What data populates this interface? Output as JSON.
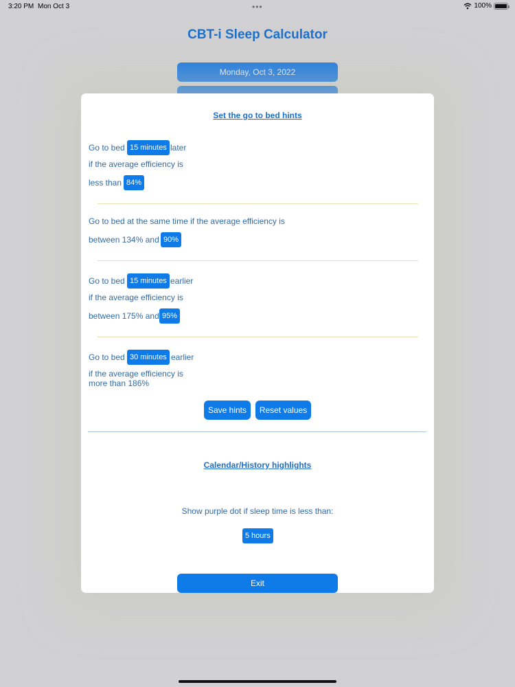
{
  "status_bar": {
    "time": "3:20 PM",
    "date": "Mon Oct 3",
    "battery": "100%",
    "battery_level": 1.0
  },
  "app": {
    "title": "CBT-i Sleep Calculator",
    "date_button": "Monday, Oct 3, 2022"
  },
  "modal": {
    "hints_title": "Set the go to bed hints",
    "rule1": {
      "prefix": "Go to bed",
      "minutes": "15 minutes",
      "suffix": "later",
      "line2": "if the average efficiency is",
      "line3_prefix": "less than",
      "percent": "84%"
    },
    "rule2": {
      "line1": "Go to bed at the same time if the average efficiency is",
      "line2_prefix": "between 134% and",
      "percent": "90%"
    },
    "rule3": {
      "prefix": "Go to bed",
      "minutes": "15 minutes",
      "suffix": "earlier",
      "line2": "if the average efficiency is",
      "line3_prefix": "between 175% and",
      "percent": "95%"
    },
    "rule4": {
      "prefix": "Go to bed",
      "minutes": "30 minutes",
      "suffix": "earlier",
      "line2": "if the average efficiency is",
      "line3": "more than 186%"
    },
    "save_label": "Save hints",
    "reset_label": "Reset values",
    "highlights_title": "Calendar/History highlights",
    "purple_dot_text": "Show purple dot if sleep time is less than:",
    "hours_value": "5 hours",
    "exit_label": "Exit"
  },
  "colors": {
    "accent": "#0f7be8",
    "title_text": "#1d6fc9",
    "body_text": "#2f6aa8",
    "background": "#d1d1d3"
  },
  "icons": [
    "wifi-icon",
    "battery-icon",
    "more-dots-icon"
  ]
}
